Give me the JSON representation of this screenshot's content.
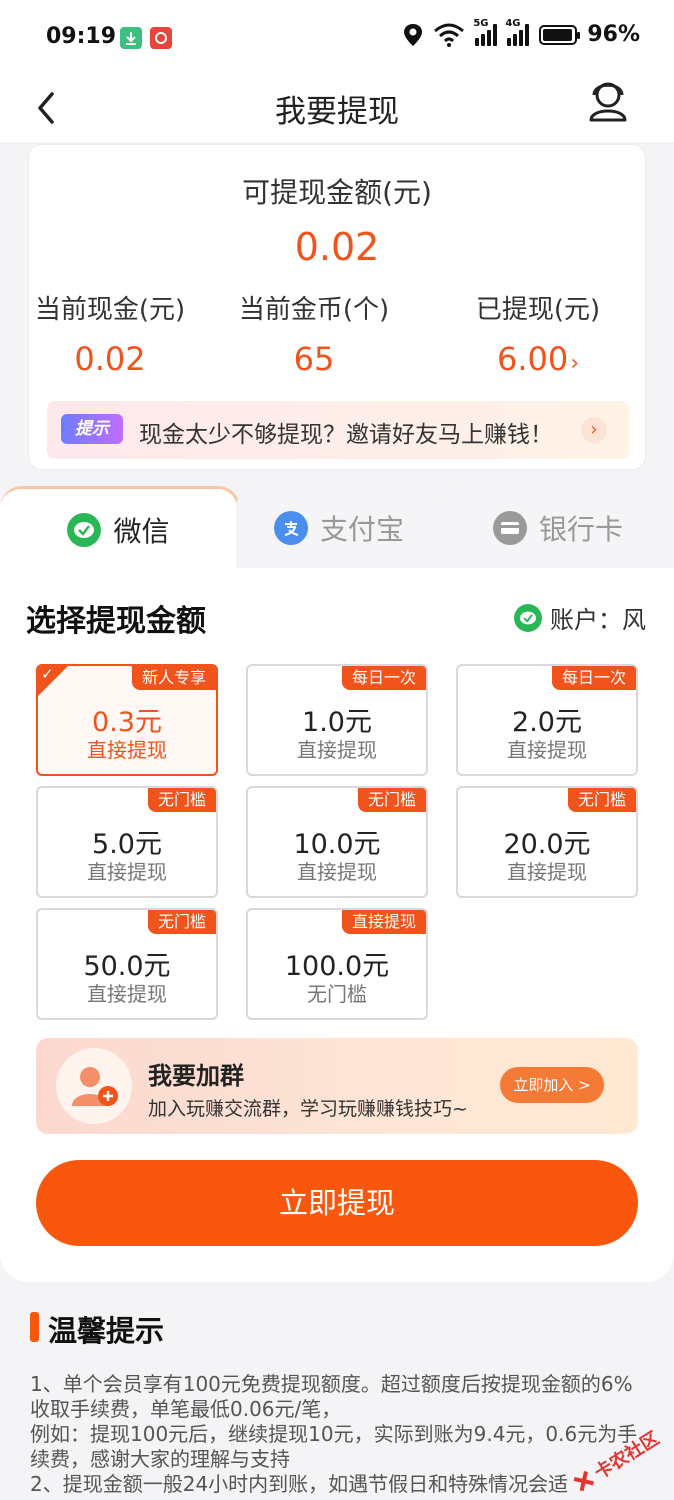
{
  "status_bar": {
    "time": "09:19",
    "net1": "5G",
    "net2": "4G",
    "battery": "96%",
    "battery_level": 0.96
  },
  "header": {
    "title": "我要提现"
  },
  "summary": {
    "available_label": "可提现金额(元)",
    "available_amount": "0.02",
    "stats": [
      {
        "label": "当前现金(元)",
        "value": "0.02"
      },
      {
        "label": "当前金币(个)",
        "value": "65"
      },
      {
        "label": "已提现(元)",
        "value": "6.00"
      }
    ],
    "tip_badge": "提示",
    "tip_text": "现金太少不够提现？邀请好友马上赚钱！"
  },
  "tabs": [
    {
      "label": "微信",
      "icon": "wechat-icon"
    },
    {
      "label": "支付宝",
      "icon": "alipay-icon"
    },
    {
      "label": "银行卡",
      "icon": "bank-card-icon"
    }
  ],
  "select": {
    "title": "选择提现金额",
    "account_label": "账户：风"
  },
  "amounts": [
    {
      "tag": "新人专享",
      "value": "0.3元",
      "sub": "直接提现",
      "selected": true
    },
    {
      "tag": "每日一次",
      "value": "1.0元",
      "sub": "直接提现"
    },
    {
      "tag": "每日一次",
      "value": "2.0元",
      "sub": "直接提现"
    },
    {
      "tag": "无门槛",
      "value": "5.0元",
      "sub": "直接提现"
    },
    {
      "tag": "无门槛",
      "value": "10.0元",
      "sub": "直接提现"
    },
    {
      "tag": "无门槛",
      "value": "20.0元",
      "sub": "直接提现"
    },
    {
      "tag": "无门槛",
      "value": "50.0元",
      "sub": "直接提现"
    },
    {
      "tag": "直接提现",
      "value": "100.0元",
      "sub": "无门槛"
    }
  ],
  "group": {
    "title": "我要加群",
    "desc": "加入玩赚交流群，学习玩赚赚钱技巧~",
    "join_label": "立即加入 >"
  },
  "withdraw_label": "立即提现",
  "notes": {
    "title": "温馨提示",
    "lines": [
      "1、单个会员享有100元免费提现额度。超过额度后按提现金额的6%收取手续费，单笔最低0.06元/笔，",
      "例如：提现100元后，继续提现10元，实际到账为9.4元，0.6元为手续费，感谢大家的理解与支持",
      "2、提现金额一般24小时内到账，如遇节假日和特殊情况会适"
    ]
  },
  "watermark": "卡农社区",
  "colors": {
    "accent": "#f0531c",
    "wechat": "#2ab757",
    "alipay": "#4b8ef0"
  }
}
